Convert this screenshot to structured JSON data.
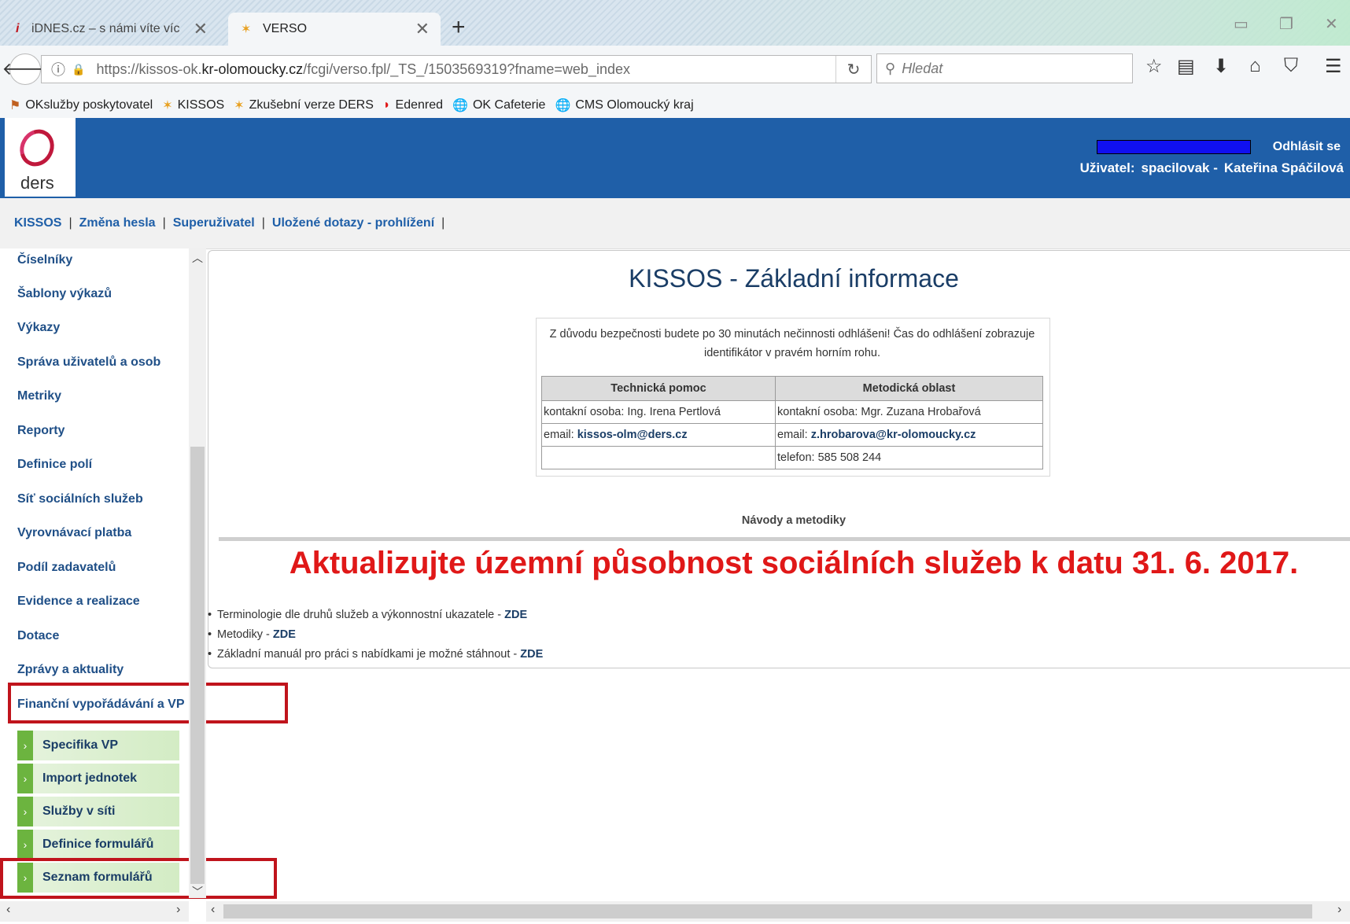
{
  "browser": {
    "tabs": [
      {
        "title": "iDNES.cz – s námi víte víc",
        "active": false
      },
      {
        "title": "VERSO",
        "active": true
      }
    ],
    "new_tab": "+",
    "url_prefix": "https://kissos-ok.",
    "url_domain": "kr-olomoucky.cz",
    "url_suffix": "/fcgi/verso.fpl/_TS_/1503569319?fname=web_index",
    "search_placeholder": "Hledat",
    "bookmarks": [
      {
        "label": "OKslužby poskytovatel",
        "icon": "bookmark-icon"
      },
      {
        "label": "KISSOS",
        "icon": "verso-icon"
      },
      {
        "label": "Zkušební verze DERS",
        "icon": "verso-icon"
      },
      {
        "label": "Edenred",
        "icon": "edenred-icon"
      },
      {
        "label": "OK Cafeterie",
        "icon": "globe-icon"
      },
      {
        "label": "CMS Olomoucký kraj",
        "icon": "globe-icon"
      }
    ]
  },
  "header": {
    "logo_text": "ders",
    "logout": "Odhlásit se",
    "user_label": "Uživatel:",
    "user_login": "spacilovak -",
    "user_name": "Kateřina Spáčilová",
    "brand_color": "#1f5fa8"
  },
  "topmenu": {
    "items": [
      "KISSOS",
      "Změna hesla",
      "Superuživatel",
      "Uložené dotazy - prohlížení"
    ],
    "separator": "|"
  },
  "sidebar": {
    "items": [
      "Číselníky",
      "Šablony výkazů",
      "Výkazy",
      "Správa uživatelů a osob",
      "Metriky",
      "Reporty",
      "Definice polí",
      "Síť sociálních služeb",
      "Vyrovnávací platba",
      "Podíl zadavatelů",
      "Evidence a realizace",
      "Dotace",
      "Zprávy a aktuality",
      "Finanční vypořádávání a VP"
    ],
    "subitems": [
      "Specifika VP",
      "Import jednotek",
      "Služby v síti",
      "Definice formulářů",
      "Seznam formulářů"
    ],
    "highlight_color": "#c0141c"
  },
  "main": {
    "title": "KISSOS - Základní informace",
    "notice": "Z důvodu bezpečnosti budete po 30 minutách nečinnosti odhlášeni! Čas do odhlášení zobrazuje identifikátor v pravém horním rohu.",
    "table": {
      "headers": [
        "Technická pomoc",
        "Metodická oblast"
      ],
      "rows": [
        {
          "left_prefix": "kontakní osoba: Ing. Irena Pertlová",
          "left_bold": "",
          "right_prefix": "kontakní osoba: Mgr. Zuzana Hrobařová",
          "right_bold": ""
        },
        {
          "left_prefix": "email: ",
          "left_bold": "kissos-olm@ders.cz",
          "right_prefix": "email: ",
          "right_bold": "z.hrobarova@kr-olomoucky.cz"
        },
        {
          "left_prefix": "",
          "left_bold": "",
          "right_prefix": "telefon: 585 508 244",
          "right_bold": ""
        }
      ]
    },
    "guides_heading": "Návody a metodiky",
    "announcement": "Aktualizujte územní působnost sociálních služeb k datu 31. 6. 2017.",
    "announcement_color": "#e01818",
    "links": [
      {
        "text": "Terminologie dle druhů služeb a výkonnostní ukazatele - ",
        "link": "ZDE"
      },
      {
        "text": "Metodiky - ",
        "link": "ZDE"
      },
      {
        "text": "Základní manuál pro práci s nabídkami je možné stáhnout - ",
        "link": "ZDE"
      }
    ]
  }
}
